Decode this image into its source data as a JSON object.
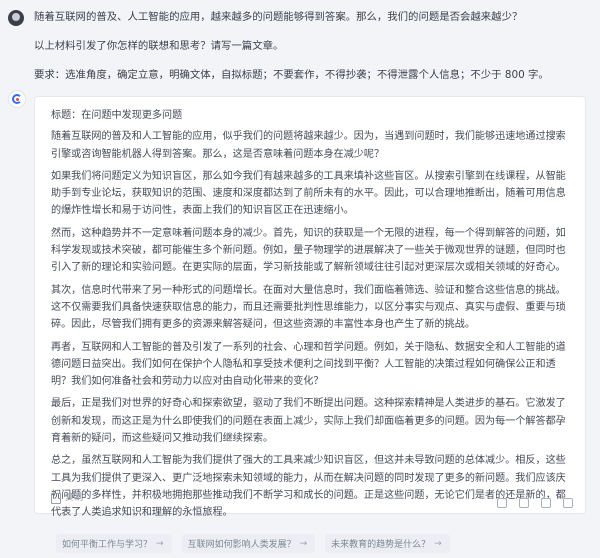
{
  "user": {
    "paragraphs": [
      "随着互联网的普及、人工智能的应用，越来越多的问题能够得到答案。那么，我们的问题是否会越来越少？",
      "以上材料引发了你怎样的联想和思考？请写一篇文章。",
      "要求：选准角度，确定立意，明确文体，自拟标题；不要套作，不得抄袭；不得泄露个人信息；不少于 800 字。"
    ]
  },
  "answer": {
    "title": "标题：在问题中发现更多问题",
    "paragraphs": [
      "随着互联网的普及和人工智能的应用，似乎我们的问题将越来越少。因为，当遇到问题时，我们能够迅速地通过搜索引擎或咨询智能机器人得到答案。那么，这是否意味着问题本身在减少呢？",
      "如果我们将问题定义为知识盲区，那么如今我们有越来越多的工具来填补这些盲区。从搜索引擎到在线课程，从智能助手到专业论坛，获取知识的范围、速度和深度都达到了前所未有的水平。因此，可以合理地推断出，随着可用信息的爆炸性增长和易于访问性，表面上我们的知识盲区正在迅速缩小。",
      "然而，这种趋势并不一定意味着问题本身的减少。首先，知识的获取是一个无限的进程，每一个得到解答的问题，如科学发现或技术突破，都可能催生多个新问题。例如，量子物理学的进展解决了一些关于微观世界的谜题，但同时也引入了新的理论和实验问题。在更实际的层面，学习新技能或了解新领域往往引起对更深层次或相关领域的好奇心。",
      "其次，信息时代带来了另一种形式的问题增长。在面对大量信息时，我们面临着筛选、验证和整合这些信息的挑战。这不仅需要我们具备快速获取信息的能力，而且还需要批判性思维能力，以区分事实与观点、真实与虚假、重要与琐碎。因此，尽管我们拥有更多的资源来解答疑问，但这些资源的丰富性本身也产生了新的挑战。",
      "再者，互联网和人工智能的普及引发了一系列的社会、心理和哲学问题。例如，关于隐私、数据安全和人工智能的道德问题日益突出。我们如何在保护个人隐私和享受技术便利之间找到平衡？人工智能的决策过程如何确保公正和透明？我们如何准备社会和劳动力以应对由自动化带来的变化？",
      "最后，正是我们对世界的好奇心和探索欲望，驱动了我们不断提出问题。这种探索精神是人类进步的基石。它激发了创新和发现，而这正是为什么即使我们的问题在表面上减少，实际上我们却面临着更多的问题。因为每一个解答都孕育着新的疑问，而这些疑问又推动我们继续探索。",
      "总之，虽然互联网和人工智能为我们提供了强大的工具来减少知识盲区，但这并未导致问题的总体减少。相反，这些工具为我们提供了更深入、更广泛地探索未知领域的能力，从而在解决问题的同时发现了更多的新问题。我们应该庆祝问题的多样性，并积极地拥抱那些推动我们不断学习和成长的问题。正是这些问题，无论它们是者的还是新的，都代表了人类追求知识和理解的永恒旅程。"
    ],
    "copy_label": "复制",
    "icons": [
      "refresh-icon",
      "share-icon",
      "thumb-up-icon",
      "thumb-down-icon"
    ]
  },
  "suggestions": [
    "如何平衡工作与学习？",
    "互联网如何影响人类发展？",
    "未来教育的趋势是什么？"
  ]
}
